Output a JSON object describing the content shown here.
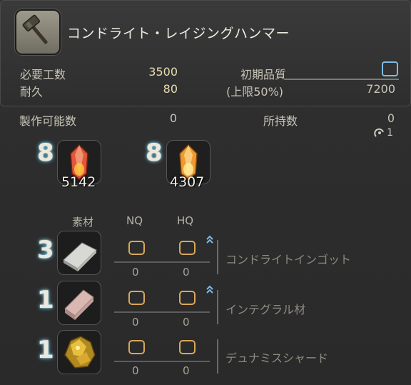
{
  "item": {
    "name": "コンドライト・レイジングハンマー"
  },
  "stats": {
    "required_work_label": "必要工数",
    "required_work_value": "3500",
    "durability_label": "耐久",
    "durability_value": "80",
    "initial_quality_label": "初期品質",
    "quality_cap_label": "(上限50%)",
    "quality_cap_value": "7200",
    "craftable_label": "製作可能数",
    "craftable_value": "0",
    "owned_label": "所持数",
    "owned_value": "0",
    "owned_sub_value": "1"
  },
  "crystals": [
    {
      "required": "8",
      "held": "5142",
      "color": "#e2563a"
    },
    {
      "required": "8",
      "held": "4307",
      "color": "#f09a2e"
    }
  ],
  "materials_header": {
    "materials": "素材",
    "nq": "NQ",
    "hq": "HQ"
  },
  "materials": [
    {
      "count": "3",
      "name": "コンドライトインゴット",
      "nq_held": "0",
      "hq_held": "0",
      "icon": "ingot-icon",
      "hq_arrow": true
    },
    {
      "count": "1",
      "name": "インテグラル材",
      "nq_held": "0",
      "hq_held": "0",
      "icon": "lumber-icon",
      "hq_arrow": true
    },
    {
      "count": "1",
      "name": "デュナミスシャード",
      "nq_held": "0",
      "hq_held": "0",
      "icon": "shard-icon",
      "hq_arrow": false
    }
  ],
  "colors": {
    "accent_blue": "#7fbbe6",
    "slot_gold": "#d8a858",
    "value_text": "#e8dcb0"
  }
}
